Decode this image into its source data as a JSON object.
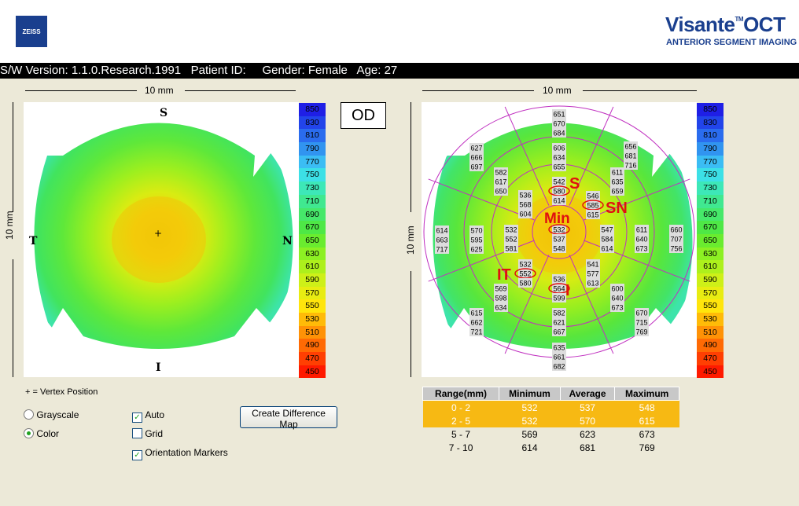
{
  "header": {
    "logo_text": "ZEISS",
    "brand": "Visante",
    "brand_tm": "TM",
    "brand_suffix": "OCT",
    "subtitle": "ANTERIOR SEGMENT IMAGING"
  },
  "info_bar": "S/W Version: 1.1.0.Research.1991   Patient ID:     Gender: Female   Age: 27",
  "left_map": {
    "width_label": "10 mm",
    "height_label": "10 mm",
    "markers": {
      "S": "S",
      "I": "I",
      "T": "T",
      "N": "N"
    },
    "vertex_symbol": "+"
  },
  "eye_label": "OD",
  "right_map": {
    "width_label": "10 mm",
    "height_label": "10 mm",
    "zone_labels": [
      "S",
      "SN",
      "Min",
      "IT",
      "I"
    ],
    "sectors": [
      {
        "values": [
          "651",
          "670",
          "684"
        ]
      },
      {
        "values": [
          "606",
          "634",
          "655"
        ]
      },
      {
        "values": [
          "542",
          "580",
          "614"
        ]
      },
      {
        "values": [
          "656",
          "681",
          "716"
        ]
      },
      {
        "values": [
          "611",
          "635",
          "659"
        ]
      },
      {
        "values": [
          "546",
          "585",
          "615"
        ]
      },
      {
        "values": [
          "627",
          "666",
          "697"
        ]
      },
      {
        "values": [
          "582",
          "617",
          "650"
        ]
      },
      {
        "values": [
          "536",
          "568",
          "604"
        ]
      },
      {
        "values": [
          "532",
          "537",
          "548"
        ]
      },
      {
        "values": [
          "614",
          "663",
          "717"
        ]
      },
      {
        "values": [
          "570",
          "595",
          "625"
        ]
      },
      {
        "values": [
          "532",
          "552",
          "581"
        ]
      },
      {
        "values": [
          "547",
          "584",
          "614"
        ]
      },
      {
        "values": [
          "611",
          "640",
          "673"
        ]
      },
      {
        "values": [
          "660",
          "707",
          "756"
        ]
      },
      {
        "values": [
          "532",
          "552",
          "580"
        ]
      },
      {
        "values": [
          "541",
          "577",
          "613"
        ]
      },
      {
        "values": [
          "536",
          "564",
          "599"
        ]
      },
      {
        "values": [
          "569",
          "598",
          "634"
        ]
      },
      {
        "values": [
          "600",
          "640",
          "673"
        ]
      },
      {
        "values": [
          "615",
          "662",
          "721"
        ]
      },
      {
        "values": [
          "582",
          "621",
          "667"
        ]
      },
      {
        "values": [
          "670",
          "715",
          "769"
        ]
      },
      {
        "values": [
          "635",
          "661",
          "682"
        ]
      }
    ]
  },
  "color_scale": {
    "values": [
      "850",
      "830",
      "810",
      "790",
      "770",
      "750",
      "730",
      "710",
      "690",
      "670",
      "650",
      "630",
      "610",
      "590",
      "570",
      "550",
      "530",
      "510",
      "490",
      "470",
      "450"
    ],
    "colors": [
      "#1f1fe6",
      "#2244ea",
      "#2a6cee",
      "#3194f0",
      "#3bbdf4",
      "#3ce0e6",
      "#3de8b8",
      "#40e890",
      "#46e86a",
      "#4ee846",
      "#6aec2f",
      "#8cf023",
      "#adf01c",
      "#cef018",
      "#e8ec12",
      "#ffe50c",
      "#ffbb08",
      "#ff9206",
      "#ff6a04",
      "#ff3f02",
      "#ff1a00"
    ]
  },
  "legend_note": "+ = Vertex Position",
  "controls": {
    "grayscale": "Grayscale",
    "color": "Color",
    "auto": "Auto",
    "grid": "Grid",
    "orientation": "Orientation Markers",
    "diff_button": "Create Difference Map"
  },
  "stats": {
    "headers": [
      "Range(mm)",
      "Minimum",
      "Average",
      "Maximum"
    ],
    "rows": [
      [
        "0 - 2",
        "532",
        "537",
        "548"
      ],
      [
        "2 - 5",
        "532",
        "570",
        "615"
      ],
      [
        "5 - 7",
        "569",
        "623",
        "673"
      ],
      [
        "7 - 10",
        "614",
        "681",
        "769"
      ]
    ]
  }
}
